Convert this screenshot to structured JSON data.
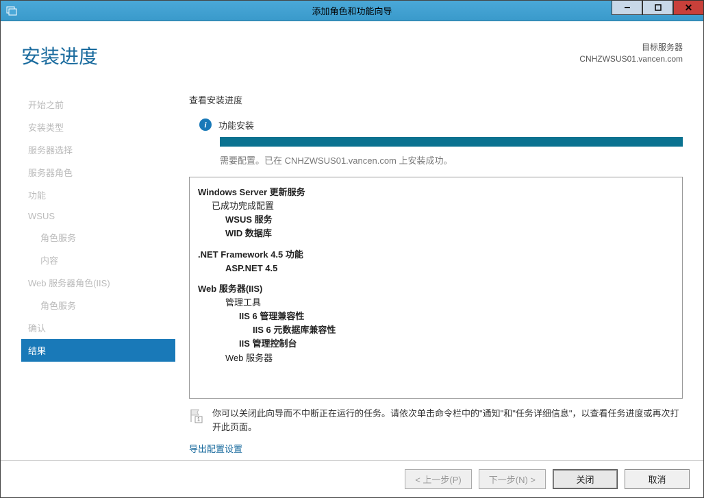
{
  "window": {
    "title": "添加角色和功能向导"
  },
  "header": {
    "page_title": "安装进度",
    "target_label": "目标服务器",
    "target_server": "CNHZWSUS01.vancen.com"
  },
  "sidebar": {
    "items": [
      {
        "label": "开始之前",
        "indent": false
      },
      {
        "label": "安装类型",
        "indent": false
      },
      {
        "label": "服务器选择",
        "indent": false
      },
      {
        "label": "服务器角色",
        "indent": false
      },
      {
        "label": "功能",
        "indent": false
      },
      {
        "label": "WSUS",
        "indent": false
      },
      {
        "label": "角色服务",
        "indent": true
      },
      {
        "label": "内容",
        "indent": true
      },
      {
        "label": "Web 服务器角色(IIS)",
        "indent": false
      },
      {
        "label": "角色服务",
        "indent": true
      },
      {
        "label": "确认",
        "indent": false
      },
      {
        "label": "结果",
        "indent": false,
        "active": true
      }
    ]
  },
  "main": {
    "section_label": "查看安装进度",
    "status_text": "功能安装",
    "progress_msg": "需要配置。已在 CNHZWSUS01.vancen.com 上安装成功。",
    "results_lines": [
      {
        "text": "Windows Server 更新服务",
        "cls": "rb-h"
      },
      {
        "text": "已成功完成配置",
        "cls": "rb-l1"
      },
      {
        "text": "WSUS 服务",
        "cls": "rb-l2"
      },
      {
        "text": "WID 数据库",
        "cls": "rb-l2"
      },
      {
        "text": ".NET Framework 4.5 功能",
        "cls": "rb-h",
        "gap": true
      },
      {
        "text": "ASP.NET 4.5",
        "cls": "rb-l2"
      },
      {
        "text": "Web 服务器(IIS)",
        "cls": "rb-h",
        "gap": true
      },
      {
        "text": "管理工具",
        "cls": "rb-l2n"
      },
      {
        "text": "IIS 6 管理兼容性",
        "cls": "rb-l3"
      },
      {
        "text": "IIS 6 元数据库兼容性",
        "cls": "rb-l4"
      },
      {
        "text": "IIS 管理控制台",
        "cls": "rb-l3"
      },
      {
        "text": "Web 服务器",
        "cls": "rb-l2n"
      }
    ],
    "note_text": "你可以关闭此向导而不中断正在运行的任务。请依次单击命令栏中的\"通知\"和\"任务详细信息\"，以查看任务进度或再次打开此页面。",
    "export_link": "导出配置设置"
  },
  "footer": {
    "prev": "< 上一步(P)",
    "next": "下一步(N) >",
    "close": "关闭",
    "cancel": "取消"
  }
}
